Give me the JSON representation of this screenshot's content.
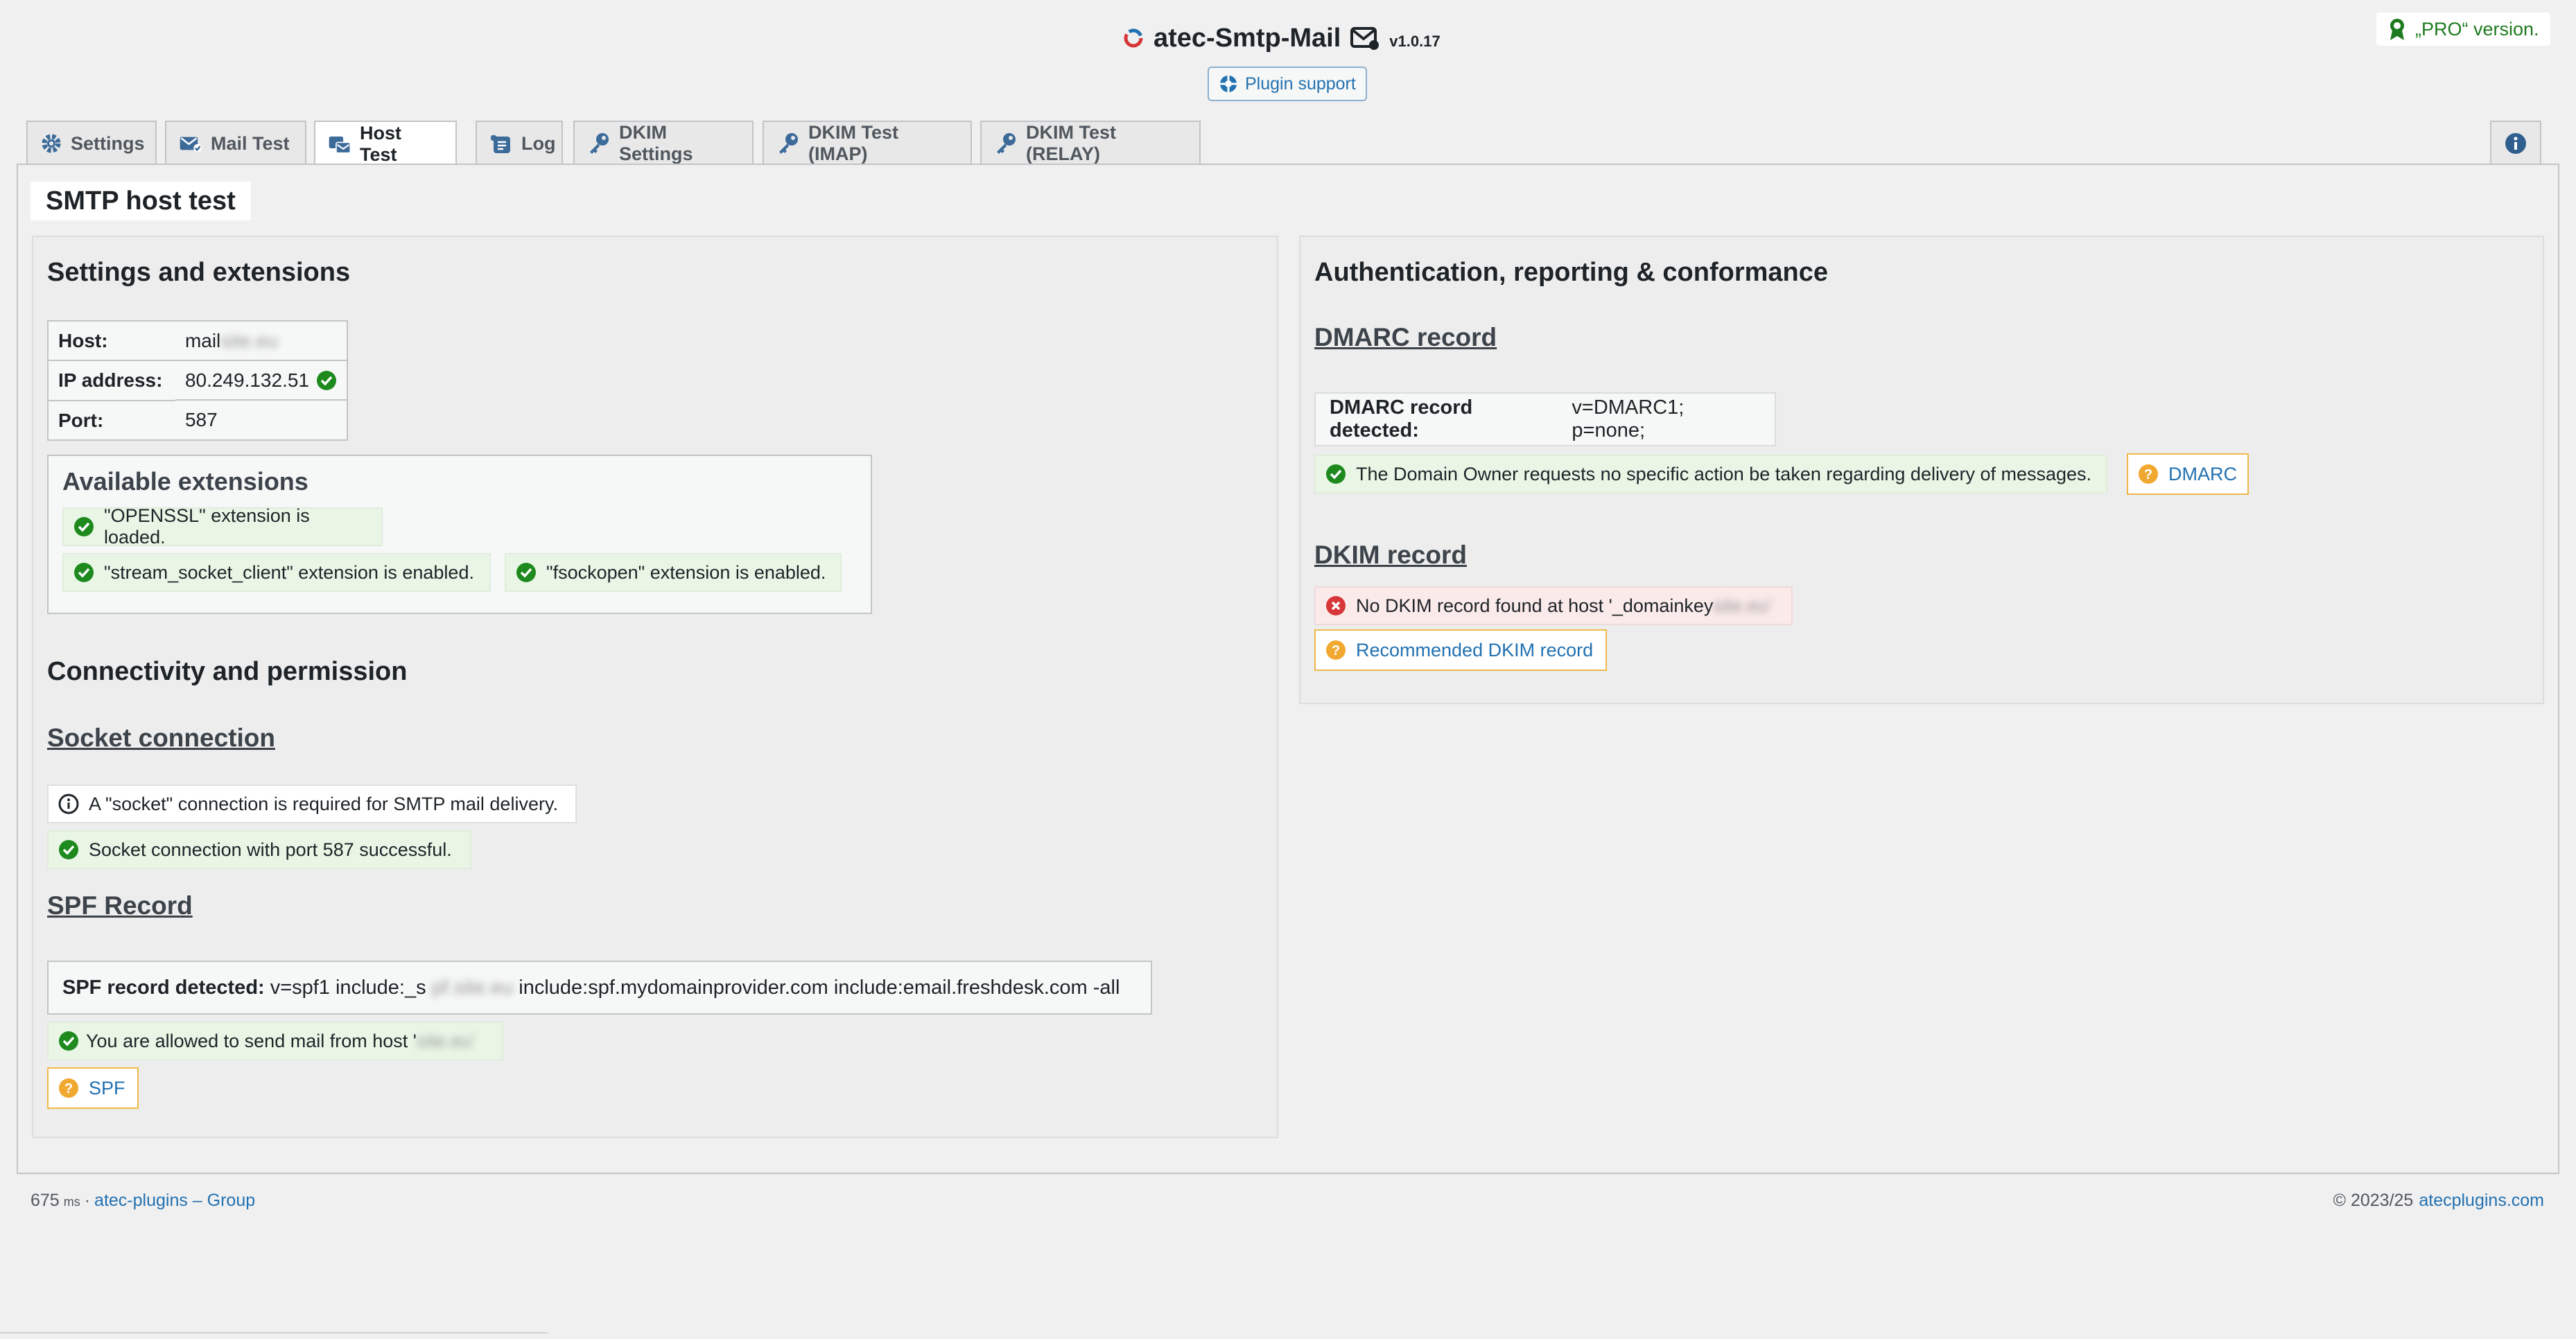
{
  "header": {
    "app_name": "atec-Smtp-Mail",
    "version": "v1.0.17",
    "support_label": "Plugin support",
    "pro_label": "„PRO“ version."
  },
  "tabs": [
    {
      "label": "Settings",
      "icon": "gear-icon"
    },
    {
      "label": "Mail Test",
      "icon": "mail-check-icon"
    },
    {
      "label": "Host Test",
      "icon": "host-test-icon",
      "active": true
    },
    {
      "label": "Log",
      "icon": "log-icon"
    },
    {
      "label": "DKIM Settings",
      "icon": "key-icon"
    },
    {
      "label": "DKIM Test (IMAP)",
      "icon": "key-icon"
    },
    {
      "label": "DKIM Test (RELAY)",
      "icon": "key-icon"
    }
  ],
  "page_title": "SMTP host test",
  "left": {
    "heading": "Settings and extensions",
    "host_table": [
      {
        "key": "Host:",
        "value": "mail",
        "blurred": "site.eu"
      },
      {
        "key": "IP address:",
        "value": "80.249.132.51"
      },
      {
        "key": "Port:",
        "value": "587"
      }
    ],
    "extensions": {
      "title": "Available extensions",
      "items": [
        "\"OPENSSL\" extension is loaded.",
        "\"stream_socket_client\" extension is enabled.",
        "\"fsockopen\" extension is enabled."
      ]
    },
    "connectivity_heading": "Connectivity and permission",
    "socket": {
      "title": "Socket connection",
      "info": "A \"socket\" connection is required for SMTP mail delivery.",
      "success": "Socket connection with port 587 successful."
    },
    "spf": {
      "title": "SPF Record",
      "detected_label": "SPF record detected:",
      "record_prefix": "v=spf1 include:_s",
      "record_blurred": "pf.site.eu",
      "record_suffix": "include:spf.mydomainprovider.com include:email.freshdesk.com -all",
      "allowed": "You are allowed to send mail from host '",
      "allowed_blurred": "site.eu'",
      "help_label": "SPF"
    }
  },
  "right": {
    "heading": "Authentication, reporting & conformance",
    "dmarc": {
      "title": "DMARC record",
      "detected_label": "DMARC record detected:",
      "record": "v=DMARC1; p=none;",
      "policy_text": "The Domain Owner requests no specific action be taken regarding delivery of messages.",
      "help_label": "DMARC"
    },
    "dkim": {
      "title": "DKIM record",
      "error": "No DKIM record found at host '_domainkey",
      "error_blurred": "site.eu'",
      "recommend_label": "Recommended DKIM record"
    }
  },
  "footer": {
    "ms_value": "675",
    "ms_unit": "ms",
    "separator": "·",
    "group_link": "atec-plugins – Group",
    "copyright": "© 2023/25",
    "site_link": "atecplugins.com"
  },
  "colors": {
    "success": "#1e8a1e",
    "link": "#2271b1",
    "warning": "#f0b849",
    "error": "#d63638"
  }
}
